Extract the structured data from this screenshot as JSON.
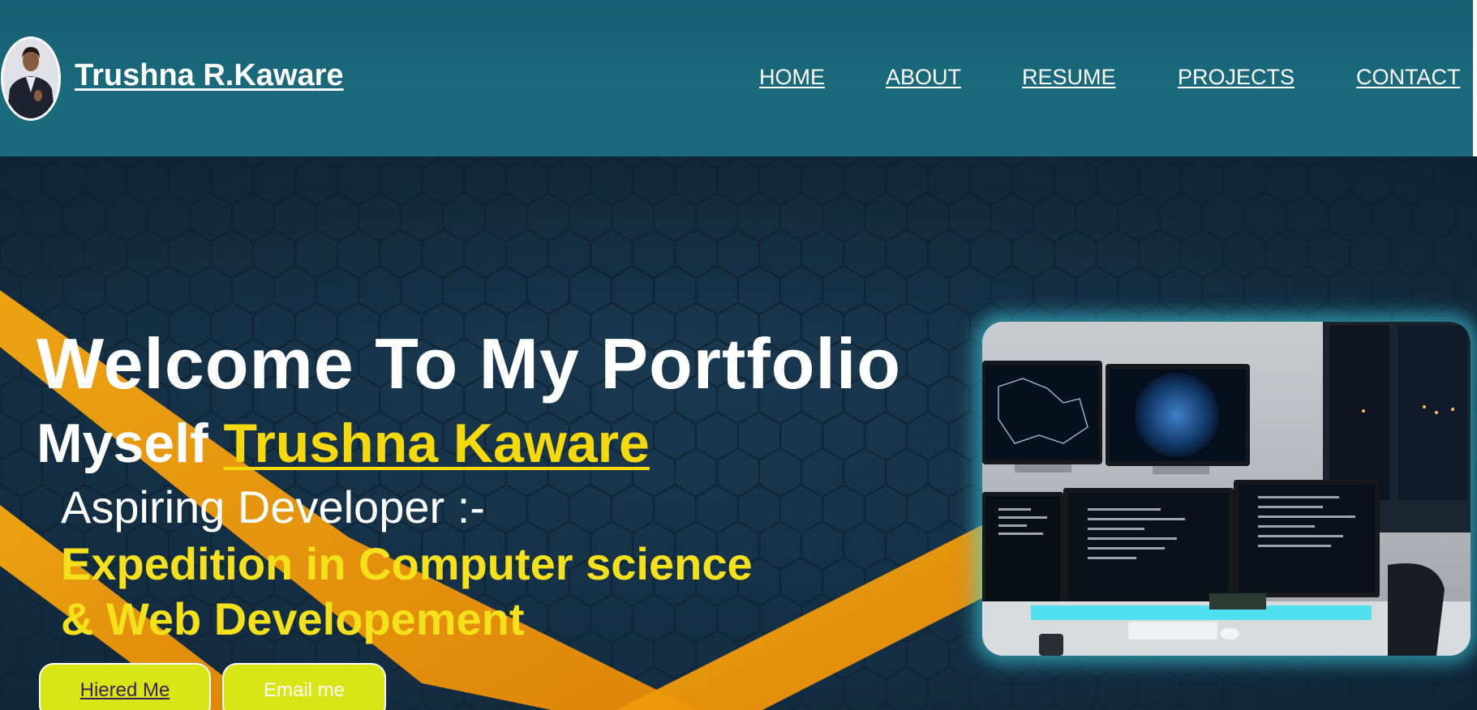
{
  "header": {
    "brand_name": "Trushna R.Kaware",
    "avatar_icon": "profile-photo",
    "nav": {
      "home": "HOME",
      "about": "ABOUT",
      "resume": "RESUME",
      "projects": "PROJECTS",
      "contact": "CONTACT"
    }
  },
  "hero": {
    "title": "Welcome To My Portfolio",
    "myself_prefix": "Myself",
    "name": "Trushna Kaware",
    "role": "Aspiring Developer :-",
    "tagline_line1": "Expedition in Computer science",
    "tagline_line2": "& Web Developement",
    "buttons": {
      "hire": "Hiered Me",
      "email": "Email me"
    }
  },
  "colors": {
    "navbar": "#1a6b7d",
    "hero_bg": "#163349",
    "accent_yellow": "#f5d90a",
    "button": "#d7e614",
    "ribbon_orange": "#f39c12",
    "image_glow": "#40dcf0"
  }
}
